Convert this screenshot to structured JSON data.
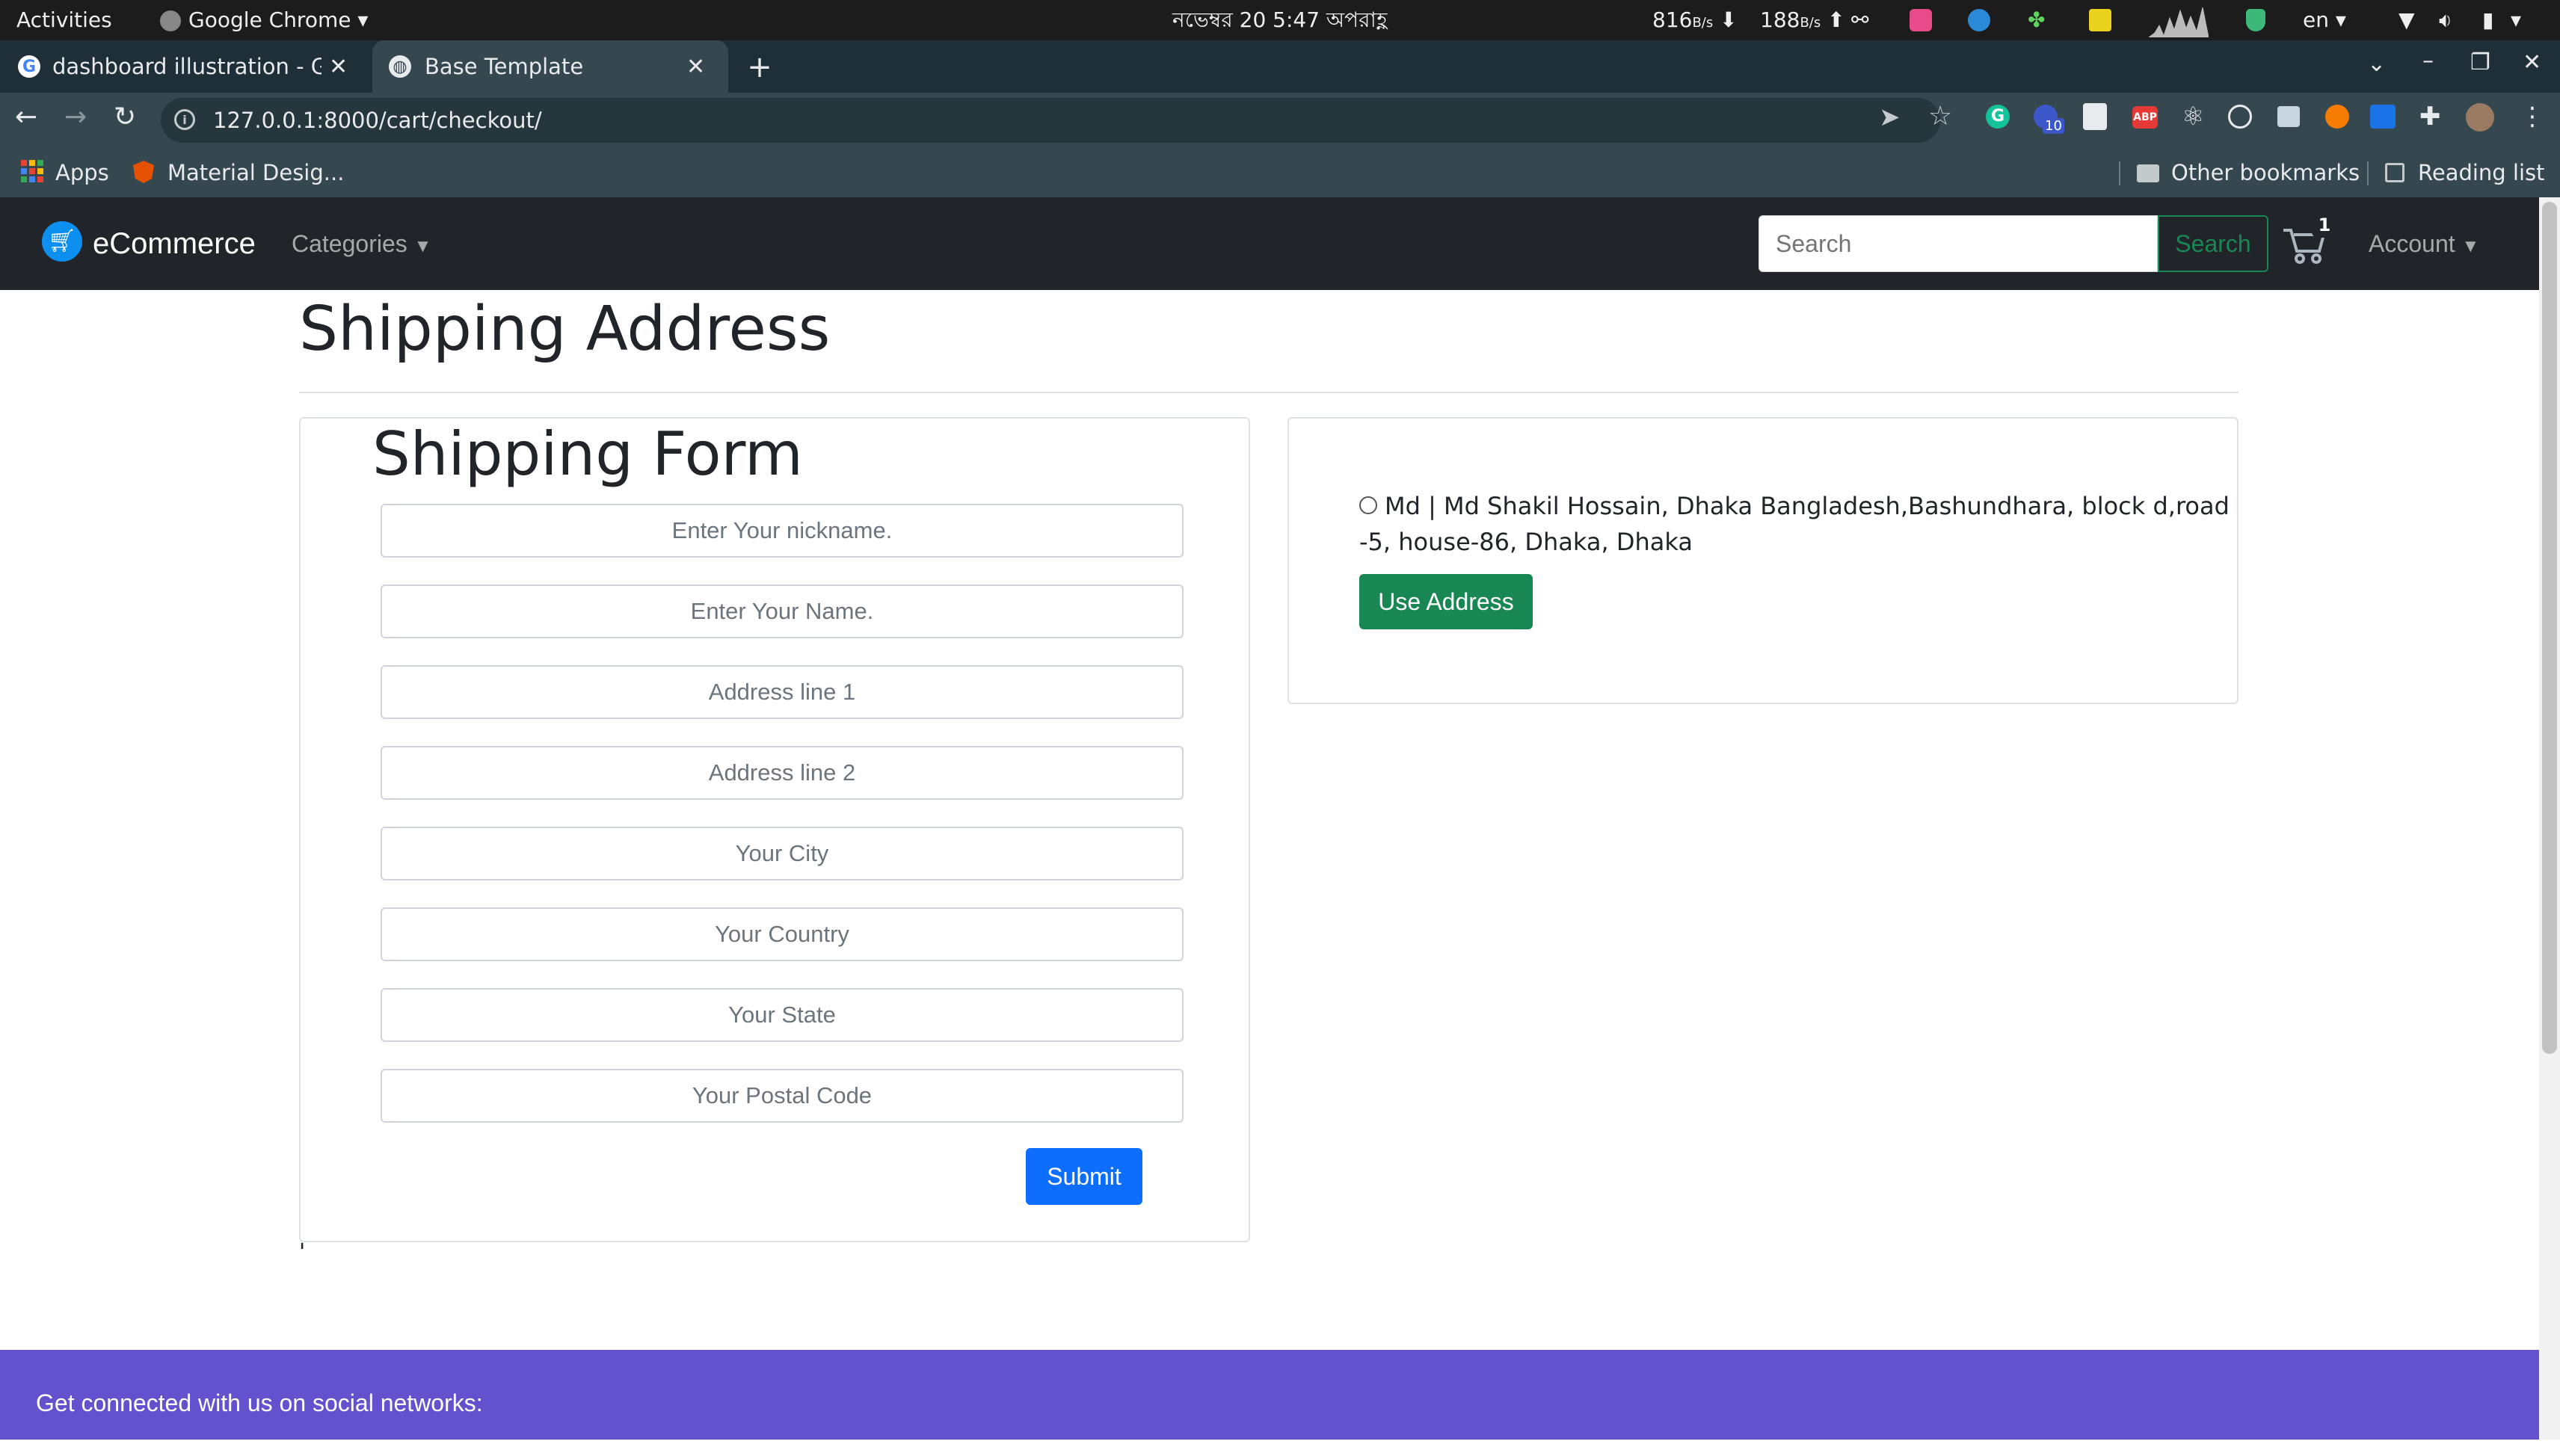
{
  "system_bar": {
    "activities": "Activities",
    "app_name": "Google Chrome",
    "datetime": "নভেম্বর 20  5:47 অপরাহ্ণ",
    "net_down": "816",
    "net_down_unit": "B/s",
    "net_up": "188",
    "net_up_unit": "B/s",
    "lang": "en"
  },
  "browser": {
    "tabs": [
      {
        "title": "dashboard illustration - G",
        "active": false
      },
      {
        "title": "Base Template",
        "active": true
      }
    ],
    "url": "127.0.0.1:8000/cart/checkout/",
    "bookmarks": {
      "apps_label": "Apps",
      "material_label": "Material Desig...",
      "other_label": "Other bookmarks",
      "reading_label": "Reading list"
    },
    "extension_badge": "10"
  },
  "navbar": {
    "brand": "eCommerce",
    "categories_label": "Categories",
    "search_placeholder": "Search",
    "search_button": "Search",
    "cart_count": "1",
    "account_label": "Account"
  },
  "page": {
    "title": "Shipping Address",
    "form_title": "Shipping Form",
    "fields": [
      "Enter Your nickname.",
      "Enter Your Name.",
      "Address line 1",
      "Address line 2",
      "Your City",
      "Your Country",
      "Your State",
      "Your Postal Code"
    ],
    "submit_label": "Submit",
    "saved_address_line1": "Md | Md Shakil Hossain, Dhaka Bangladesh,Bashundhara, block d,road",
    "saved_address_line2": "-5, house-86, Dhaka, Dhaka",
    "use_address_label": "Use Address",
    "stray_mark": "'"
  },
  "footer": {
    "social_text": "Get connected with us on social networks:"
  },
  "colors": {
    "navbar_bg": "#212529",
    "primary": "#0d6efd",
    "success": "#198754",
    "footer_bg": "#6351ce"
  }
}
